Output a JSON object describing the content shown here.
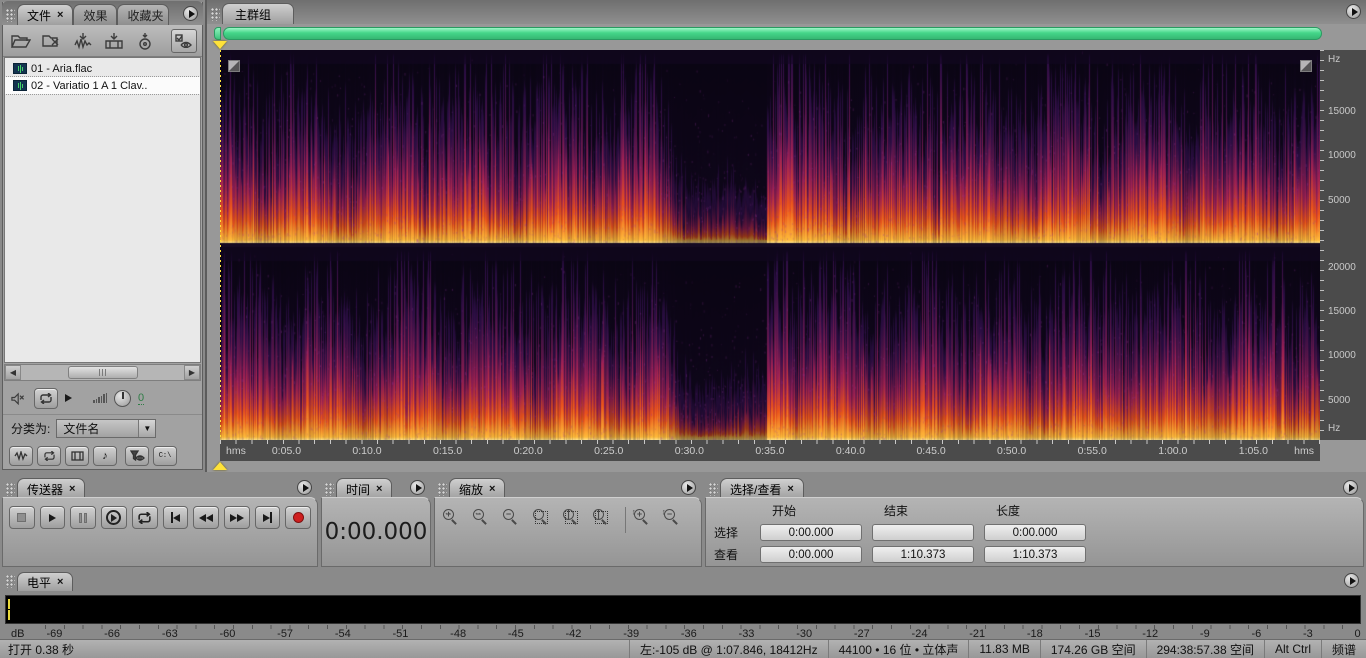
{
  "files_panel": {
    "tabs": [
      {
        "label": "文件"
      },
      {
        "label": "效果"
      },
      {
        "label": "收藏夹"
      }
    ],
    "files": [
      {
        "label": "01 - Aria.flac"
      },
      {
        "label": "02 - Variatio 1 A 1 Clav.."
      }
    ],
    "preview_volume": "0",
    "sort_label": "分类为:",
    "sort_value": "文件名"
  },
  "main_panel": {
    "tab": "主群组",
    "freq_unit": "Hz",
    "freq_top": [
      "15000",
      "10000",
      "5000"
    ],
    "freq_bottom": [
      "20000",
      "15000",
      "10000",
      "5000"
    ],
    "time_unit": "hms",
    "timeline": [
      "0:05.0",
      "0:10.0",
      "0:15.0",
      "0:20.0",
      "0:25.0",
      "0:30.0",
      "0:35.0",
      "0:40.0",
      "0:45.0",
      "0:50.0",
      "0:55.0",
      "1:00.0",
      "1:05.0"
    ]
  },
  "transport": {
    "title": "传送器"
  },
  "time_panel": {
    "title": "时间",
    "value": "0:00.000"
  },
  "zoom_panel": {
    "title": "缩放"
  },
  "selection_panel": {
    "title": "选择/查看",
    "headers": {
      "start": "开始",
      "end": "结束",
      "length": "长度"
    },
    "rows": [
      {
        "label": "选择",
        "start": "0:00.000",
        "end": "",
        "length": "0:00.000"
      },
      {
        "label": "查看",
        "start": "0:00.000",
        "end": "1:10.373",
        "length": "1:10.373"
      }
    ]
  },
  "levels_panel": {
    "title": "电平",
    "unit": "dB",
    "scale": [
      "-69",
      "-66",
      "-63",
      "-60",
      "-57",
      "-54",
      "-51",
      "-48",
      "-45",
      "-42",
      "-39",
      "-36",
      "-33",
      "-30",
      "-27",
      "-24",
      "-21",
      "-18",
      "-15",
      "-12",
      "-9",
      "-6",
      "-3",
      "0"
    ]
  },
  "status_bar": {
    "left": "打开 0.38 秒",
    "cells": [
      "左:-105 dB @  1:07.846, 18412Hz",
      "44100 • 16 位 • 立体声",
      "11.83 MB",
      "174.26 GB 空间",
      "294:38:57.38 空间",
      "Alt Ctrl",
      "频谱"
    ]
  },
  "colors": {
    "scroll_green": "#44d689",
    "record_red": "#cf1f1f",
    "marker_yellow": "#ffe23a",
    "ruler_bg": "#4b4b4b"
  }
}
